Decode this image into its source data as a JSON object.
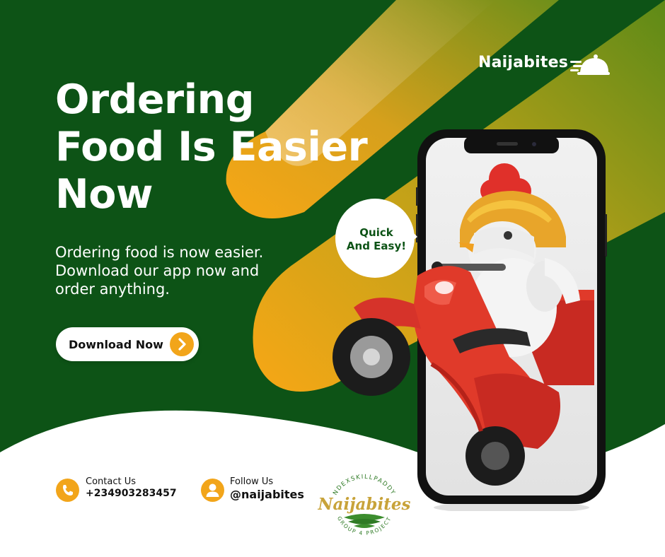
{
  "brand": {
    "name": "Naijabites",
    "icon": "delivery-cloche-icon"
  },
  "headline": {
    "line1": "Ordering",
    "line2": "Food Is Easier",
    "line3": "Now"
  },
  "subtext": {
    "line1": "Ordering food is now easier.",
    "line2": "Download our app now and",
    "line3": "order anything."
  },
  "cta": {
    "label": "Download Now",
    "icon": "chevron-right-icon"
  },
  "bubble": {
    "line1": "Quick",
    "line2": "And Easy!"
  },
  "contact": {
    "label": "Contact Us",
    "value": "+234903283457",
    "icon": "phone-icon"
  },
  "follow": {
    "label": "Follow Us",
    "value": "@naijabites",
    "icon": "user-icon"
  },
  "seal": {
    "arc_top": "NDEXSKILLPADDY",
    "word": "Naijabites",
    "arc_bottom": "GROUP 4 PROJECT"
  },
  "colors": {
    "dark_green": "#0d5316",
    "olive": "#6f8f13",
    "orange": "#f2a51a",
    "white": "#ffffff",
    "scooter_red": "#e03a2a",
    "seal_gold": "#c8a33a"
  }
}
